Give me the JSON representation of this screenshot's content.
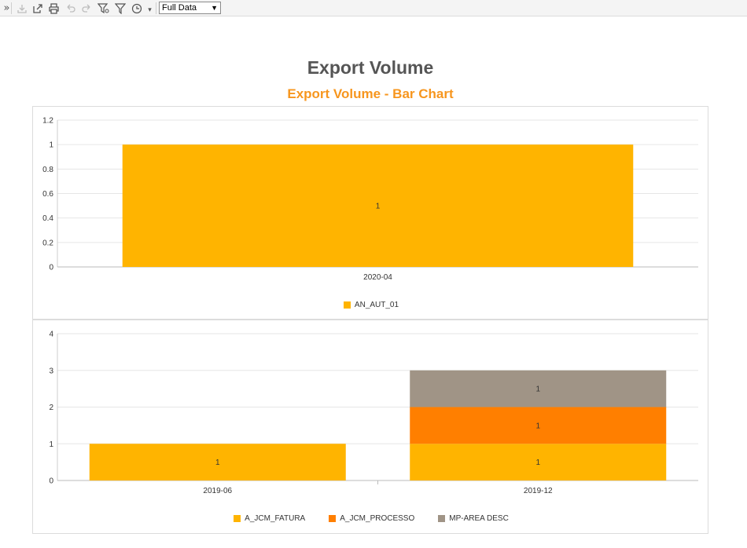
{
  "toolbar": {
    "icons": [
      "expand-icon",
      "download-icon",
      "export-icon",
      "print-icon",
      "undo-icon",
      "redo-icon",
      "filter-settings-icon",
      "filter-icon",
      "clock-icon"
    ],
    "view_select": {
      "selected": "Full Data"
    }
  },
  "title": "Export Volume",
  "subtitle": "Export Volume - Bar Chart",
  "colors": {
    "title": "#555555",
    "subtitle": "#f7961e",
    "series": [
      "#ffb400",
      "#ff7f00",
      "#a09486"
    ]
  },
  "chart_data": [
    {
      "type": "bar",
      "categories": [
        "2020-04"
      ],
      "series": [
        {
          "name": "AN_AUT_01",
          "values": [
            1
          ],
          "color": "#ffb400"
        }
      ],
      "ylim": [
        0,
        1.2
      ],
      "yticks": [
        "0",
        "0.2",
        "0.4",
        "0.6",
        "0.8",
        "1",
        "1.2"
      ],
      "grid": true,
      "legend": "bottom-center"
    },
    {
      "type": "bar",
      "stacked": true,
      "categories": [
        "2019-06",
        "2019-12"
      ],
      "series": [
        {
          "name": "A_JCM_FATURA",
          "values": [
            1,
            1
          ],
          "color": "#ffb400"
        },
        {
          "name": "A_JCM_PROCESSO",
          "values": [
            0,
            1
          ],
          "color": "#ff7f00"
        },
        {
          "name": "MP-AREA DESC",
          "values": [
            0,
            1
          ],
          "color": "#a09486"
        }
      ],
      "ylim": [
        0,
        4
      ],
      "yticks": [
        "0",
        "1",
        "2",
        "3",
        "4"
      ],
      "grid": true,
      "legend": "bottom-center"
    }
  ]
}
